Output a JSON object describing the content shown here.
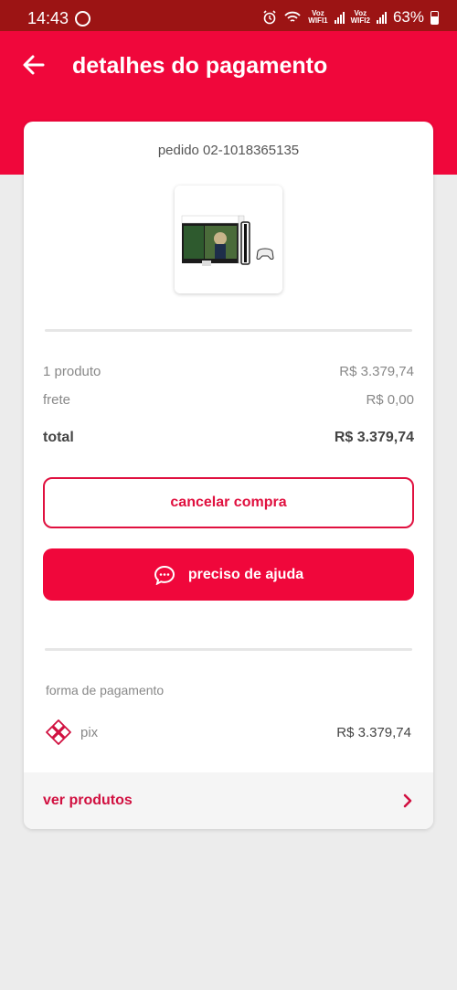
{
  "status_bar": {
    "time": "14:43",
    "net1": "Voz",
    "net1_sub": "WIFI1",
    "net2": "Voz",
    "net2_sub": "WIFI2",
    "battery": "63%"
  },
  "header": {
    "title": "detalhes do pagamento"
  },
  "order": {
    "id_text": "pedido 02-1018365135"
  },
  "summary": {
    "products_label": "1 produto",
    "products_value": "R$ 3.379,74",
    "shipping_label": "frete",
    "shipping_value": "R$ 0,00",
    "total_label": "total",
    "total_value": "R$ 3.379,74"
  },
  "actions": {
    "cancel_label": "cancelar compra",
    "help_label": "preciso de ajuda"
  },
  "payment": {
    "section_label": "forma de pagamento",
    "method": "pix",
    "amount": "R$ 3.379,74"
  },
  "footer": {
    "view_products_label": "ver produtos"
  },
  "colors": {
    "brand": "#f0073b",
    "status_bar": "#9c1414",
    "accent_text": "#d11040"
  }
}
